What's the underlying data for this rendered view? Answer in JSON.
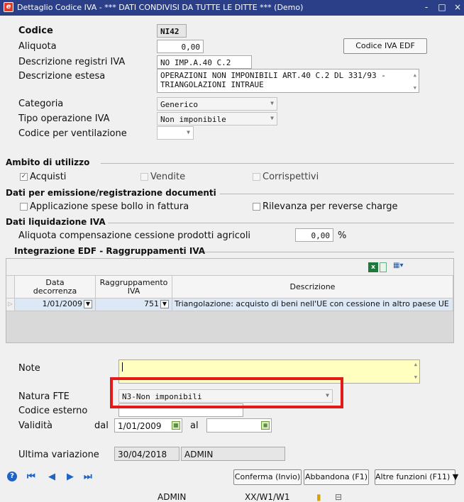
{
  "window": {
    "title": "Dettaglio Codice IVA -   *** DATI CONDIVISI DA TUTTE LE DITTE ***     (Demo)",
    "minimize": "-",
    "maximize": "□",
    "close": "×"
  },
  "form": {
    "codice_label": "Codice",
    "codice_value": "NI42",
    "aliquota_label": "Aliquota",
    "aliquota_value": "0,00",
    "codice_iva_edf_button": "Codice IVA EDF",
    "descr_registri_label": "Descrizione registri IVA",
    "descr_registri_value": "NO IMP.A.40 C.2",
    "descr_estesa_label": "Descrizione estesa",
    "descr_estesa_line1": "OPERAZIONI NON IMPONIBILI ART.40 C.2 DL 331/93 -",
    "descr_estesa_line2": "TRIANGOLAZIONI INTRAUE",
    "categoria_label": "Categoria",
    "categoria_value": "Generico",
    "tipo_operazione_label": "Tipo operazione IVA",
    "tipo_operazione_value": "Non imponibile",
    "codice_ventilazione_label": "Codice per ventilazione",
    "codice_ventilazione_value": ""
  },
  "ambito": {
    "title": "Ambito di utilizzo",
    "acquisti": "Acquisti",
    "acquisti_checked": true,
    "vendite": "Vendite",
    "corrispettivi": "Corrispettivi"
  },
  "emissione": {
    "title": "Dati per emissione/registrazione documenti",
    "bollo": "Applicazione spese bollo in fattura",
    "reverse_charge": "Rilevanza per reverse charge"
  },
  "liquidazione": {
    "title": "Dati liquidazione IVA",
    "aliquota_label": "Aliquota compensazione cessione prodotti agricoli",
    "aliquota_value": "0,00",
    "percent": "%"
  },
  "edf": {
    "title": "Integrazione EDF - Raggruppamenti IVA",
    "columns": {
      "data_line1": "Data",
      "data_line2": "decorrenza",
      "ragg_line1": "Raggruppamento",
      "ragg_line2": "IVA",
      "descrizione": "Descrizione"
    },
    "rows": [
      {
        "data": "1/01/2009",
        "ragg": "751",
        "descrizione": "Triangolazione: acquisto di beni nell'UE con cessione in altro paese UE"
      }
    ]
  },
  "bottom": {
    "note_label": "Note",
    "note_value": "",
    "natura_label": "Natura FTE",
    "natura_value": "N3-Non imponibili",
    "codice_esterno_label": "Codice esterno",
    "codice_esterno_value": "",
    "validita_label": "Validità",
    "dal_label": "dal",
    "dal_value": "1/01/2009",
    "al_label": "al",
    "al_value": "",
    "ultima_variazione_label": "Ultima variazione",
    "ultima_variazione_date": "30/04/2018",
    "ultima_variazione_user": "ADMIN"
  },
  "actions": {
    "conferma": "Conferma (Invio)",
    "abbandona": "Abbandona (F1)",
    "altre_funzioni": "Altre funzioni (F11) ▼"
  },
  "status": {
    "user": "ADMIN",
    "path": "XX/W1/W1"
  }
}
